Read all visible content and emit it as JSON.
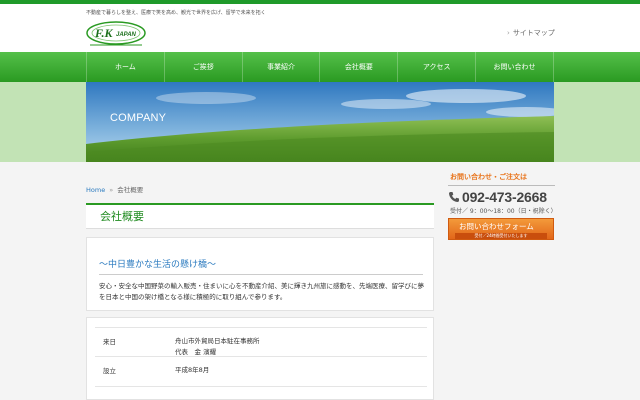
{
  "header": {
    "tagline": "不動産で暮らしを整え、医療で笑を高め、観光で世界を広げ、留学で未来を拓く",
    "logo_text": "F.K",
    "logo_sub": "JAPAN",
    "sitemap_label": "サイトマップ"
  },
  "nav": {
    "items": [
      {
        "label": "ホーム"
      },
      {
        "label": "ご挨拶"
      },
      {
        "label": "事業紹介"
      },
      {
        "label": "会社概要"
      },
      {
        "label": "アクセス"
      },
      {
        "label": "お問い合わせ"
      }
    ]
  },
  "hero": {
    "title": "COMPANY"
  },
  "breadcrumb": {
    "home": "Home",
    "current": "会社概要"
  },
  "page": {
    "title": "会社概要",
    "subtitle": "〜中日豊かな生活の懸け橋〜",
    "body": "安心・安全な中国野菜の輸入販売・住まいに心を不動産介紹、美に輝き九州旅に感動を、先端医療、留学びに夢を日本と中国の架け橋となる様に積極的に取り組んで参ります。"
  },
  "company_table": {
    "rows": [
      {
        "key": "来日",
        "value_line1": "舟山市外貿局日本駐在事務所",
        "value_line2": "代表　金 濱耀"
      },
      {
        "key": "設立",
        "value_line1": "平成8年8月"
      }
    ]
  },
  "sidebar": {
    "contact_title": "お問い合わせ・ご注文は",
    "phone": "092-473-2668",
    "hours": "受付／ 9：00〜18：00（日・祝除く）",
    "form_button_label": "お問い合わせフォーム",
    "form_button_sub": "受付／24時間受付いたします"
  },
  "colors": {
    "brand_green": "#2a9a22",
    "accent_orange": "#e8731a",
    "link_blue": "#2a7abf"
  }
}
